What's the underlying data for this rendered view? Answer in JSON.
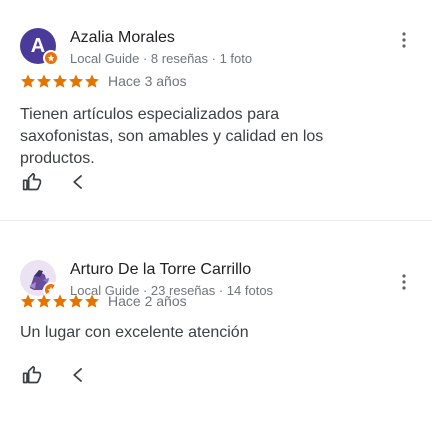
{
  "reviews": [
    {
      "author": "Azalia Morales",
      "avatar_letter": "A",
      "meta": "Local Guide · 8 reseñas · 1 foto",
      "rating": 5,
      "when": "Hace 3 años",
      "text": "Tienen artículos especializados para saxofonistas, son amables y calidad en los productos."
    },
    {
      "author": "Arturo De la Torre Carrillo",
      "meta": "Local Guide · 23 reseñas · 14 fotos",
      "rating": 5,
      "when": "Hace 2 años",
      "text": "Un lugar con excelente atención"
    }
  ],
  "icons": {
    "more": "more-vert-icon",
    "like": "thumb-up-icon",
    "share": "share-icon",
    "star": "star-icon",
    "badge": "local-guide-badge-icon"
  },
  "colors": {
    "star": "#e37400",
    "avatar_a": "#4a3b9b",
    "badge": "#e8710a",
    "muted": "#70757a"
  }
}
